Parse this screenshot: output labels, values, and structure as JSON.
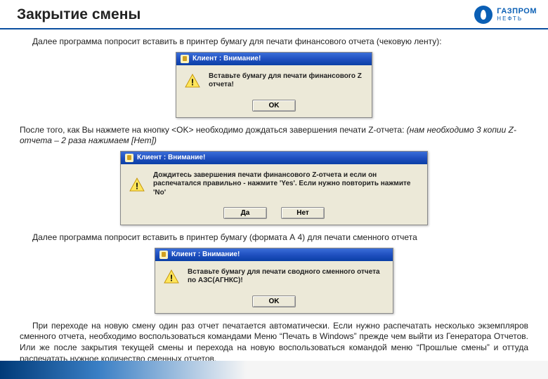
{
  "header": {
    "title": "Закрытие смены",
    "brand": "ГАЗПРОМ",
    "brand_sub": "НЕФТЬ"
  },
  "paragraphs": {
    "p1": "Далее программа попросит вставить в принтер бумагу для печати финансового отчета (чековую ленту):",
    "p2a": "После того, как Вы нажмете на кнопку <OK> необходимо дождаться завершения печати Z-отчета: ",
    "p2b": "(нам необходимо 3 копии Z-отчета – 2 раза нажимаем [Нет])",
    "p3": "Далее программа попросит вставить в принтер бумагу (формата А 4) для печати сменного отчета",
    "p4": "При переходе на новую смену один раз отчет печатается автоматически. Если нужно распечатать несколько экземпляров сменного отчета, необходимо воспользоваться командами Меню “Печать в Windows” прежде чем выйти из Генератора Отчетов. Или же после закрытия текущей смены и перехода на новую воспользоваться командой меню “Прошлые смены” и оттуда распечатать нужное количество сменных отчетов."
  },
  "dialog1": {
    "title": "Клиент : Внимание!",
    "message": "Вставьте бумагу для печати финансового Z отчета!",
    "ok": "OK"
  },
  "dialog2": {
    "title": "Клиент : Внимание!",
    "message": "Дождитесь завершения печати финансового Z-отчета и если он распечатался правильно - нажмите 'Yes'. Если нужно повторить нажмите 'No'",
    "yes": "Да",
    "no": "Нет"
  },
  "dialog3": {
    "title": "Клиент : Внимание!",
    "message": "Вставьте бумагу для печати сводного сменного отчета по АЗС(АГНКС)!",
    "ok": "OK"
  }
}
